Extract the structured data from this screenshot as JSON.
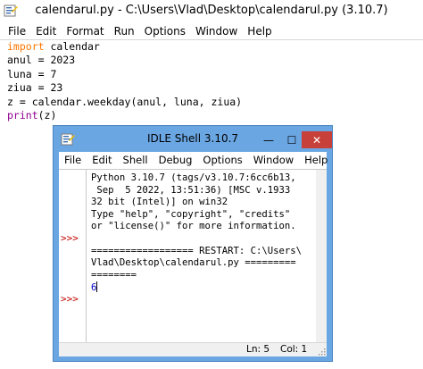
{
  "editor": {
    "title": "calendarul.py - C:\\Users\\Vlad\\Desktop\\calendarul.py (3.10.7)",
    "menu": [
      "File",
      "Edit",
      "Format",
      "Run",
      "Options",
      "Window",
      "Help"
    ],
    "code": {
      "l1_kw": "import",
      "l1_rest": " calendar",
      "l2": "anul = 2023",
      "l3": "luna = 7",
      "l4": "ziua = 23",
      "l5": "z = calendar.weekday(anul, luna, ziua)",
      "l6_bi": "print",
      "l6_rest": "(z)"
    }
  },
  "shell": {
    "title": "IDLE Shell 3.10.7",
    "buttons": {
      "minimize": "—",
      "maximize": "☐",
      "close": "✕"
    },
    "menu": [
      "File",
      "Edit",
      "Shell",
      "Debug",
      "Options",
      "Window",
      "Help"
    ],
    "prompts": [
      ">>>",
      ">>>"
    ],
    "output": {
      "banner1": "Python 3.10.7 (tags/v3.10.7:6cc6b13,",
      "banner2": " Sep  5 2022, 13:51:36) [MSC v.1933",
      "banner3": "32 bit (Intel)] on win32",
      "banner4": "Type \"help\", \"copyright\", \"credits\"",
      "banner5": "or \"license()\" for more information.",
      "restart1": "================== RESTART: C:\\Users\\",
      "restart2": "Vlad\\Desktop\\calendarul.py =========",
      "restart3": "========",
      "result": "6"
    },
    "status": {
      "ln": "Ln: 5",
      "col": "Col: 1"
    }
  },
  "colors": {
    "keyword": "#ff7700",
    "builtin": "#900090",
    "prompt": "#c00000",
    "result": "#0000c0",
    "shell_frame": "#6aa6e2",
    "close_button": "#c7413a"
  },
  "icons": [
    "idle-python-icon",
    "minimize-icon",
    "maximize-icon",
    "close-icon",
    "resize-grip-icon"
  ]
}
